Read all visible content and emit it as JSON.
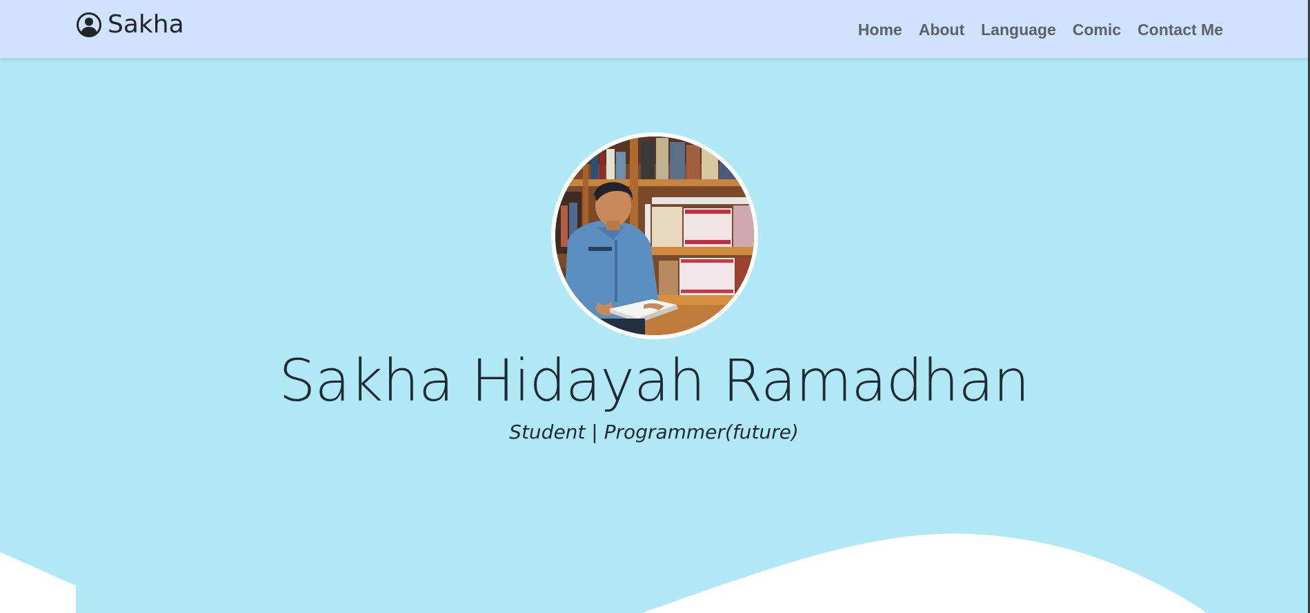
{
  "navbar": {
    "brand": "Sakha",
    "brand_icon": "person-circle-icon",
    "links": [
      {
        "label": "Home"
      },
      {
        "label": "About"
      },
      {
        "label": "Language"
      },
      {
        "label": "Comic"
      },
      {
        "label": "Contact Me"
      }
    ]
  },
  "hero": {
    "name": "Sakha Hidayah Ramadhan",
    "subtitle": "Student | Programmer(future)",
    "avatar_icon": "profile-photo"
  },
  "colors": {
    "navbar_bg": "#cfe2ff",
    "hero_bg": "#b0e9f5",
    "wave": "#ffffff",
    "text": "#212529",
    "nav_link": "#5b6168"
  }
}
